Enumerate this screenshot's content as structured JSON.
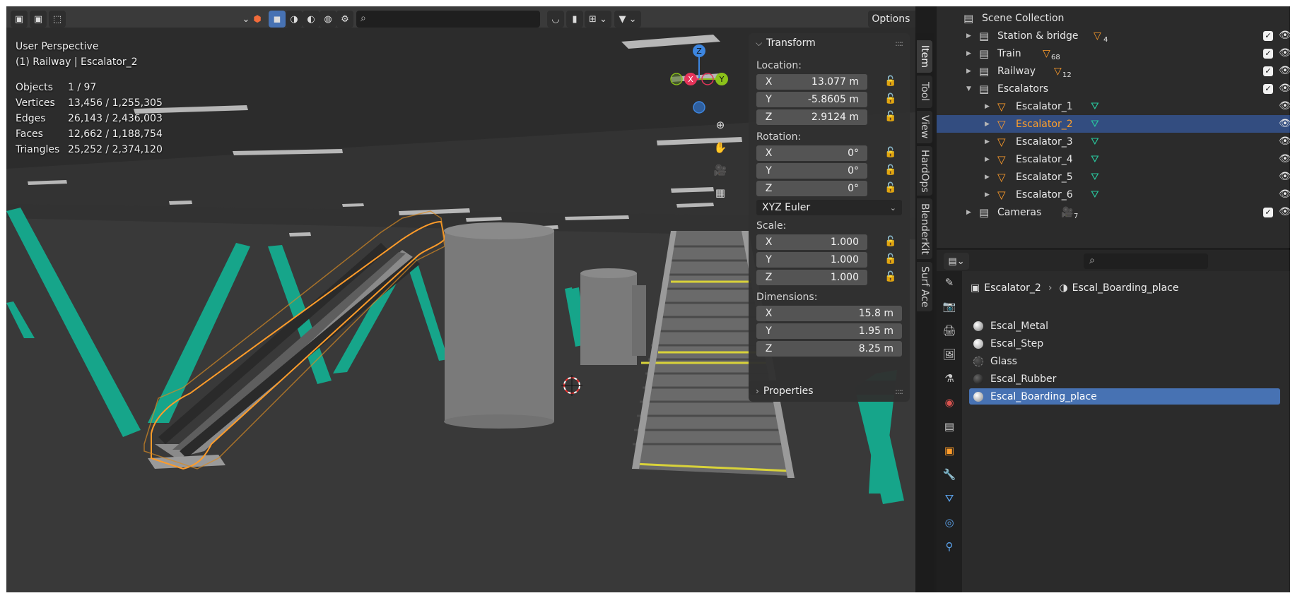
{
  "viewport": {
    "perspective_label": "User Perspective",
    "context_label": "(1) Railway | Escalator_2",
    "stats": [
      {
        "label": "Objects",
        "value": "1 / 97"
      },
      {
        "label": "Vertices",
        "value": "13,456 / 1,255,305"
      },
      {
        "label": "Edges",
        "value": "26,143 / 2,436,003"
      },
      {
        "label": "Faces",
        "value": "12,662 / 1,188,754"
      },
      {
        "label": "Triangles",
        "value": "25,252 / 2,374,120"
      }
    ],
    "options_label": "Options",
    "gizmo": {
      "x": "X",
      "y": "Y",
      "z": "Z"
    }
  },
  "transform_panel": {
    "title": "Transform",
    "location_label": "Location:",
    "location": [
      {
        "axis": "X",
        "value": "13.077 m"
      },
      {
        "axis": "Y",
        "value": "-5.8605 m"
      },
      {
        "axis": "Z",
        "value": "2.9124 m"
      }
    ],
    "rotation_label": "Rotation:",
    "rotation": [
      {
        "axis": "X",
        "value": "0°"
      },
      {
        "axis": "Y",
        "value": "0°"
      },
      {
        "axis": "Z",
        "value": "0°"
      }
    ],
    "rotation_mode": "XYZ Euler",
    "scale_label": "Scale:",
    "scale": [
      {
        "axis": "X",
        "value": "1.000"
      },
      {
        "axis": "Y",
        "value": "1.000"
      },
      {
        "axis": "Z",
        "value": "1.000"
      }
    ],
    "dimensions_label": "Dimensions:",
    "dimensions": [
      {
        "axis": "X",
        "value": "15.8 m"
      },
      {
        "axis": "Y",
        "value": "1.95 m"
      },
      {
        "axis": "Z",
        "value": "8.25 m"
      }
    ],
    "properties_label": "Properties"
  },
  "side_tabs": [
    "Item",
    "Tool",
    "View",
    "HardOps",
    "BlenderKit",
    "Surf Ace"
  ],
  "outliner": {
    "root": "Scene Collection",
    "rows": [
      {
        "label": "Station & bridge",
        "badge": "4",
        "level": 1
      },
      {
        "label": "Train",
        "badge": "68",
        "level": 1
      },
      {
        "label": "Railway",
        "badge": "12",
        "level": 1
      },
      {
        "label": "Escalators",
        "badge": "",
        "level": 1
      },
      {
        "label": "Escalator_1",
        "badge": "",
        "level": 2
      },
      {
        "label": "Escalator_2",
        "badge": "",
        "level": 2
      },
      {
        "label": "Escalator_3",
        "badge": "",
        "level": 2
      },
      {
        "label": "Escalator_4",
        "badge": "",
        "level": 2
      },
      {
        "label": "Escalator_5",
        "badge": "",
        "level": 2
      },
      {
        "label": "Escalator_6",
        "badge": "",
        "level": 2
      },
      {
        "label": "Cameras",
        "badge": "7",
        "level": 1
      }
    ]
  },
  "properties": {
    "breadcrumb_object": "Escalator_2",
    "breadcrumb_material": "Escal_Boarding_place",
    "materials": [
      "Escal_Metal",
      "Escal_Step",
      "Glass",
      "Escal_Rubber",
      "Escal_Boarding_place"
    ],
    "selected_material": "Escal_Boarding_place"
  },
  "colors": {
    "selection_blue": "#4772b3",
    "outline_orange": "#ff9c2a",
    "teal_beams": "#16a58a",
    "axis_x": "#e6345a",
    "axis_y": "#8bc21a",
    "axis_z": "#3d86e0"
  }
}
